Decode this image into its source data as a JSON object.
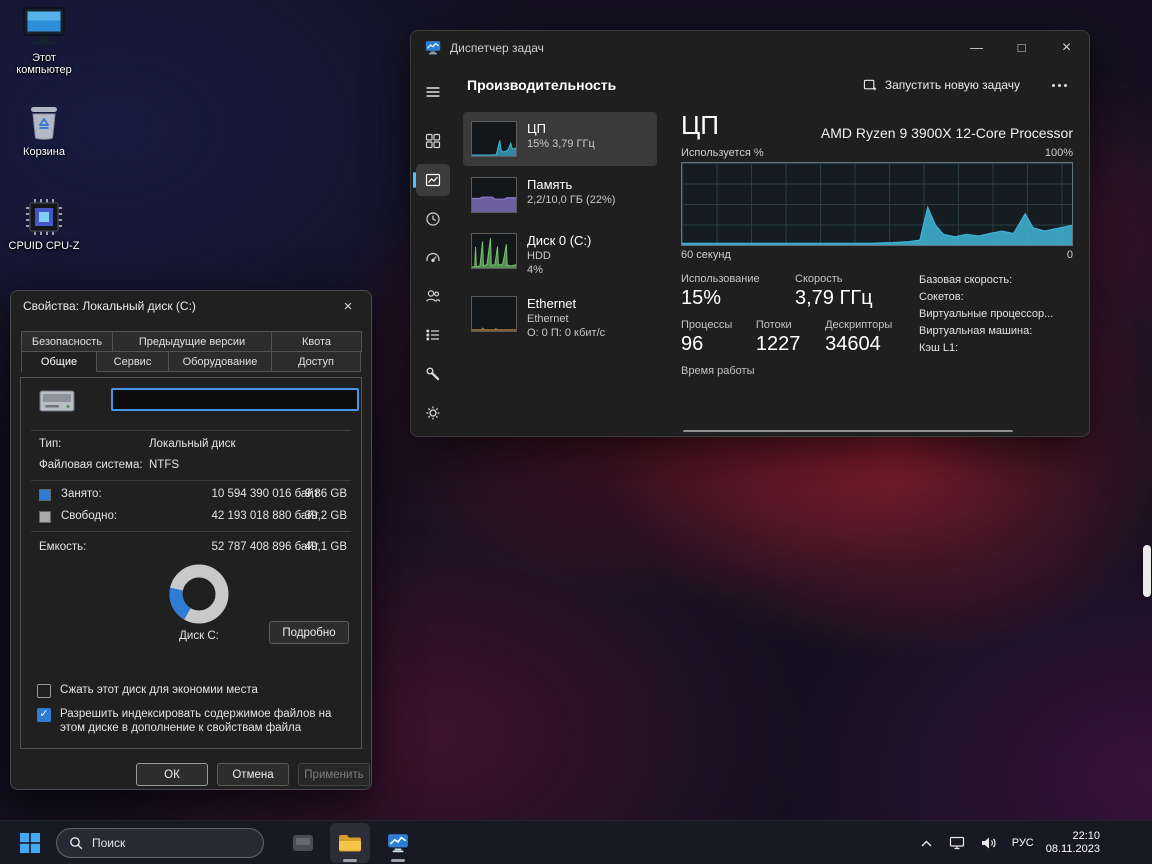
{
  "icons": {
    "minimize": "—",
    "maximize": "□",
    "close": "×",
    "check": "✓"
  },
  "desktop": {
    "icons": [
      {
        "label": "Этот компьютер"
      },
      {
        "label": "Корзина"
      },
      {
        "label": "CPUID CPU-Z"
      }
    ]
  },
  "task_manager": {
    "window_title": "Диспетчер задач",
    "page_title": "Производительность",
    "run_task_label": "Запустить новую задачу",
    "metrics": [
      {
        "name": "ЦП",
        "line1": "15% 3,79 ГГц",
        "line2": ""
      },
      {
        "name": "Память",
        "line1": "2,2/10,0 ГБ (22%)",
        "line2": ""
      },
      {
        "name": "Диск 0 (C:)",
        "line1": "HDD",
        "line2": "4%"
      },
      {
        "name": "Ethernet",
        "line1": "Ethernet",
        "line2": "О: 0 П: 0 кбит/с"
      }
    ],
    "cpu": {
      "heading": "ЦП",
      "processor": "AMD Ryzen 9 3900X 12-Core Processor",
      "graph_top_left": "Используется %",
      "graph_top_right": "100%",
      "graph_bottom_left": "60 секунд",
      "graph_bottom_right": "0",
      "stats_row1": [
        {
          "label": "Использование",
          "value": "15%"
        },
        {
          "label": "Скорость",
          "value": "3,79 ГГц"
        }
      ],
      "stats_row2": [
        {
          "label": "Процессы",
          "value": "96"
        },
        {
          "label": "Потоки",
          "value": "1227"
        },
        {
          "label": "Дескрипторы",
          "value": "34604"
        }
      ],
      "info_labels": [
        "Базовая скорость:",
        "Сокетов:",
        "Виртуальные процессор...",
        "Виртуальная машина:",
        "Кэш L1:"
      ],
      "uptime_label": "Время работы"
    }
  },
  "chart_data": {
    "type": "area",
    "title": "ЦП — Используется %",
    "ylabel": "Используется %",
    "ylim": [
      0,
      100
    ],
    "x_range": "60 секунд → 0",
    "grid": true,
    "series": [
      {
        "name": "cpu_usage_percent",
        "points": [
          [
            0,
            2
          ],
          [
            8,
            2
          ],
          [
            16,
            2
          ],
          [
            24,
            2
          ],
          [
            32,
            2
          ],
          [
            40,
            2
          ],
          [
            48,
            2
          ],
          [
            54,
            3
          ],
          [
            58,
            4
          ],
          [
            61,
            6
          ],
          [
            63,
            46
          ],
          [
            65,
            24
          ],
          [
            67,
            13
          ],
          [
            70,
            10
          ],
          [
            73,
            13
          ],
          [
            76,
            11
          ],
          [
            79,
            14
          ],
          [
            82,
            17
          ],
          [
            85,
            14
          ],
          [
            88,
            38
          ],
          [
            90,
            21
          ],
          [
            93,
            17
          ],
          [
            96,
            20
          ],
          [
            100,
            24
          ]
        ]
      }
    ],
    "sparklines": {
      "cpu": [
        [
          0,
          3
        ],
        [
          20,
          3
        ],
        [
          40,
          3
        ],
        [
          55,
          4
        ],
        [
          63,
          46
        ],
        [
          66,
          18
        ],
        [
          70,
          12
        ],
        [
          76,
          14
        ],
        [
          82,
          18
        ],
        [
          88,
          38
        ],
        [
          92,
          20
        ],
        [
          100,
          24
        ]
      ],
      "memory": [
        [
          0,
          40
        ],
        [
          18,
          40
        ],
        [
          22,
          44
        ],
        [
          46,
          44
        ],
        [
          52,
          38
        ],
        [
          74,
          38
        ],
        [
          78,
          42
        ],
        [
          100,
          42
        ]
      ],
      "disk": [
        [
          0,
          4
        ],
        [
          6,
          4
        ],
        [
          8,
          62
        ],
        [
          10,
          4
        ],
        [
          18,
          6
        ],
        [
          24,
          78
        ],
        [
          26,
          6
        ],
        [
          34,
          10
        ],
        [
          42,
          88
        ],
        [
          44,
          8
        ],
        [
          52,
          10
        ],
        [
          58,
          64
        ],
        [
          60,
          8
        ],
        [
          70,
          12
        ],
        [
          78,
          70
        ],
        [
          80,
          8
        ],
        [
          90,
          6
        ],
        [
          100,
          10
        ]
      ],
      "ethernet": [
        [
          0,
          4
        ],
        [
          22,
          4
        ],
        [
          24,
          9
        ],
        [
          28,
          4
        ],
        [
          52,
          4
        ],
        [
          54,
          7
        ],
        [
          58,
          4
        ],
        [
          100,
          4
        ]
      ]
    },
    "colors": {
      "cpu": "#3fb6d6",
      "memory": "#9180dc",
      "disk": "#74c36e",
      "ethernet": "#a87b3a"
    }
  },
  "properties_dialog": {
    "title": "Свойства: Локальный диск (C:)",
    "tabs_row1": [
      "Безопасность",
      "Предыдущие версии",
      "Квота"
    ],
    "tabs_row2": [
      "Общие",
      "Сервис",
      "Оборудование",
      "Доступ"
    ],
    "active_tab": "Общие",
    "volume_name": "",
    "type_label": "Тип:",
    "type_value": "Локальный диск",
    "fs_label": "Файловая система:",
    "fs_value": "NTFS",
    "used_label": "Занято:",
    "used_bytes": "10 594 390 016 байт",
    "used_size": "9,86 GB",
    "free_label": "Свободно:",
    "free_bytes": "42 193 018 880 байт",
    "free_size": "39,2 GB",
    "capacity_label": "Емкость:",
    "capacity_bytes": "52 787 408 896 байт",
    "capacity_size": "49,1 GB",
    "donut": {
      "used_percent": 20.1,
      "used_color": "#2f7cd6",
      "free_color": "#c9c9c9"
    },
    "disk_caption": "Диск C:",
    "details_button": "Подробно",
    "compress_checkbox": "Сжать этот диск для экономии места",
    "index_checkbox": "Разрешить индексировать содержимое файлов на этом диске в дополнение к свойствам файла",
    "ok_button": "ОК",
    "cancel_button": "Отмена",
    "apply_button": "Применить"
  },
  "taskbar": {
    "search_placeholder": "Поиск",
    "language": "РУС",
    "time": "22:10",
    "date": "08.11.2023"
  }
}
